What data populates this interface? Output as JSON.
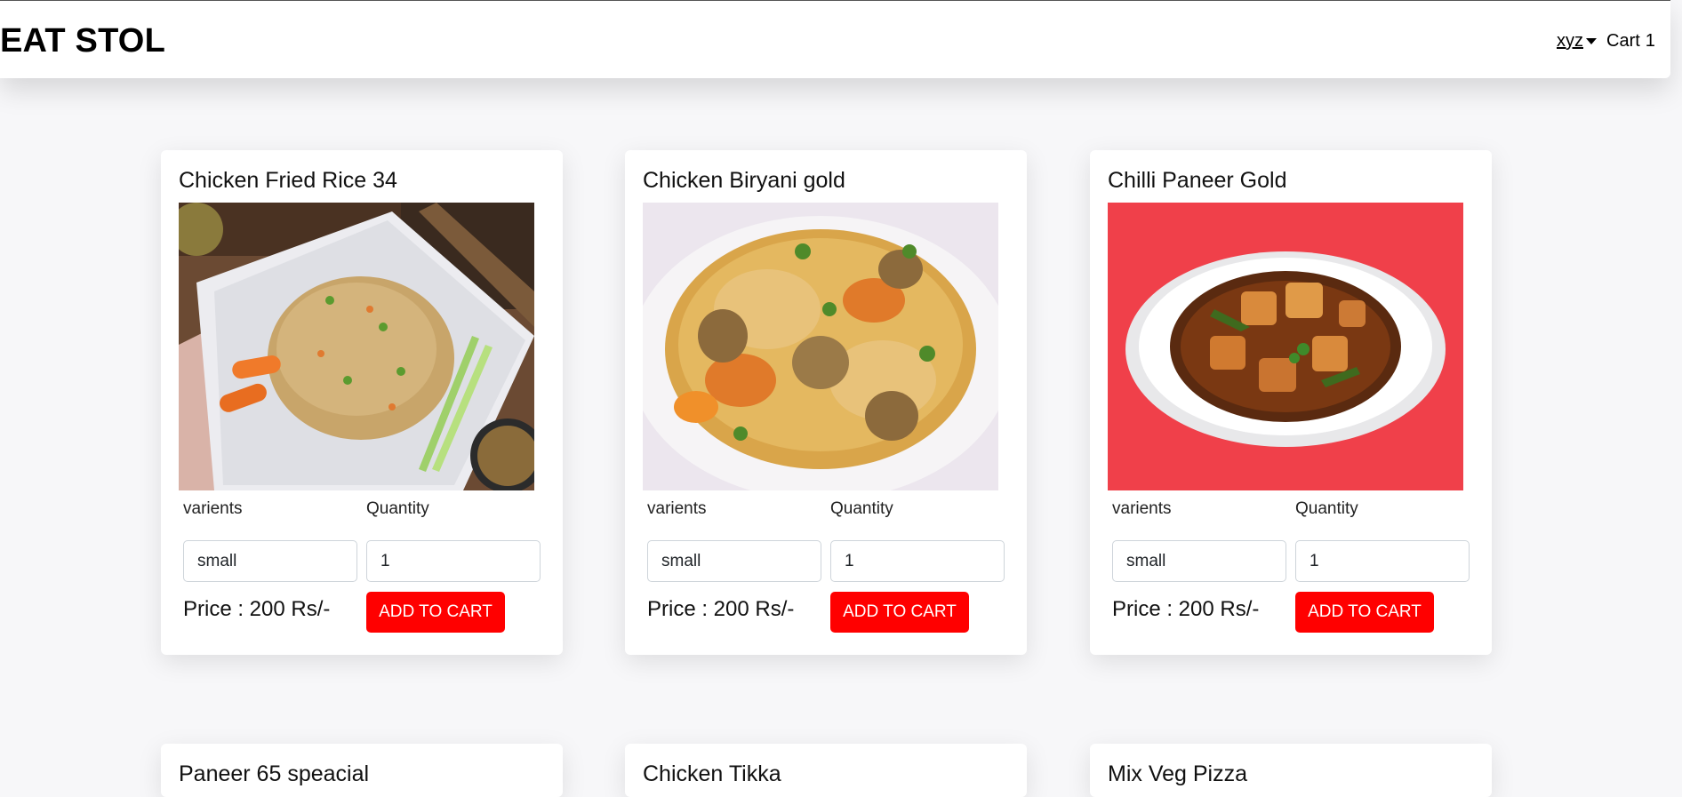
{
  "header": {
    "brand": "EAT STOL",
    "user_menu": "xyz",
    "cart_label": "Cart",
    "cart_count": "1"
  },
  "products": [
    {
      "name": "Chicken Fried Rice 34",
      "image": "fried-rice-photo",
      "variants_label": "varients",
      "quantity_label": "Quantity",
      "variant_value": "small",
      "quantity_value": "1",
      "price": "Price : 200 Rs/-",
      "button": "ADD TO CART"
    },
    {
      "name": "Chicken Biryani gold",
      "image": "biryani-photo",
      "variants_label": "varients",
      "quantity_label": "Quantity",
      "variant_value": "small",
      "quantity_value": "1",
      "price": "Price : 200 Rs/-",
      "button": "ADD TO CART"
    },
    {
      "name": "Chilli Paneer Gold",
      "image": "chilli-paneer-photo",
      "variants_label": "varients",
      "quantity_label": "Quantity",
      "variant_value": "small",
      "quantity_value": "1",
      "price": "Price : 200 Rs/-",
      "button": "ADD TO CART"
    },
    {
      "name": "Paneer 65 speacial"
    },
    {
      "name": "Chicken Tikka"
    },
    {
      "name": "Mix Veg Pizza"
    }
  ],
  "colors": {
    "accent": "#ff0000",
    "background": "#f7f7f9",
    "card": "#ffffff"
  }
}
